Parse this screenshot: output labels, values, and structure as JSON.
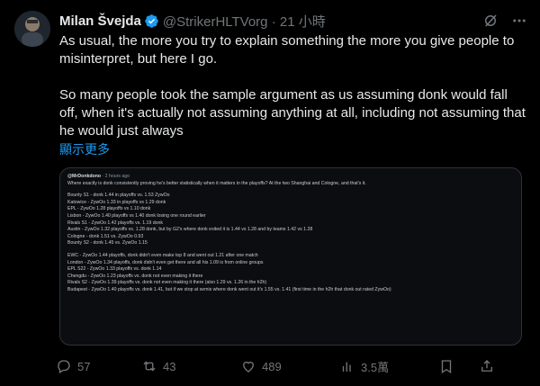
{
  "tweet": {
    "author_name": "Milan Švejda",
    "handle_time": "@StrikerHLTVorg · 21 小時",
    "paragraphs": [
      "As usual, the more you try to explain something the more you give people to misinterpret, but here I go.",
      "So many people took the sample argument as us assuming donk would fall off, when it's actually not assuming anything at all, including not assuming that he would just always"
    ],
    "show_more": "顯示更多"
  },
  "embed": {
    "handle": "@MrDonkdono",
    "time": "2 hours ago",
    "intro": "Where exactly is donk consistently proving he's better statistically when it matters in the playoffs? At the two Shanghai and Cologne, and that's it.",
    "block1": [
      "Bounty S1 - donk 1.44 in playoffs vs. 1.53 ZywOo",
      "Katowice - ZywOo 1.33 in playoffs vs 1.29 donk",
      "EPL - ZywOo 1.28 playoffs vs 1.10 donk",
      "Lisbon - ZywOo 1.40 playoffs vs 1.40 donk losing one round earlier",
      "Rivals S1 - ZywOo 1.42 playoffs vs. 1.19 donk",
      "Austin - ZywOo 1.32 playoffs vs. 1.28 donk, but by G2's where donk exited it is 1.44 vs 1.28 and by teams 1.42 vs 1.28",
      "Cologne - donk 1.51 vs. ZywOo 0.93",
      "Bounty S2 - donk 1.45 vs. ZywOo 1.15"
    ],
    "block2": [
      "EWC - ZywOo 1.44 playoffs, donk didn't even make top 8 and went out 1.21 after one match",
      "London - ZywOo 1.34 playoffs, donk didn't even get there and all his 1.09 is from online groups",
      "EPL S22 - ZywOo 1.33 playoffs vs. donk 1.14",
      "Chengdu - ZywOo 1.23 playoffs vs. donk not even making it there",
      "Rivals S2 - ZywOo 1.39 playoffs vs. donk not even making it there (also 1.29 vs. 1.26 in the h2h)",
      "Budapest - ZywOo 1.40 playoffs vs. donk 1.41, but if we stop at semis where donk went out it's 1.55 vs. 1.41 (first time in the h2h that donk out rated ZywOo)"
    ]
  },
  "actions": {
    "replies": "57",
    "retweets": "43",
    "likes": "489",
    "views": "3.5萬"
  },
  "colors": {
    "background": "#000000",
    "text": "#e7e9ea",
    "muted": "#71767b",
    "accent": "#1d9bf0"
  }
}
